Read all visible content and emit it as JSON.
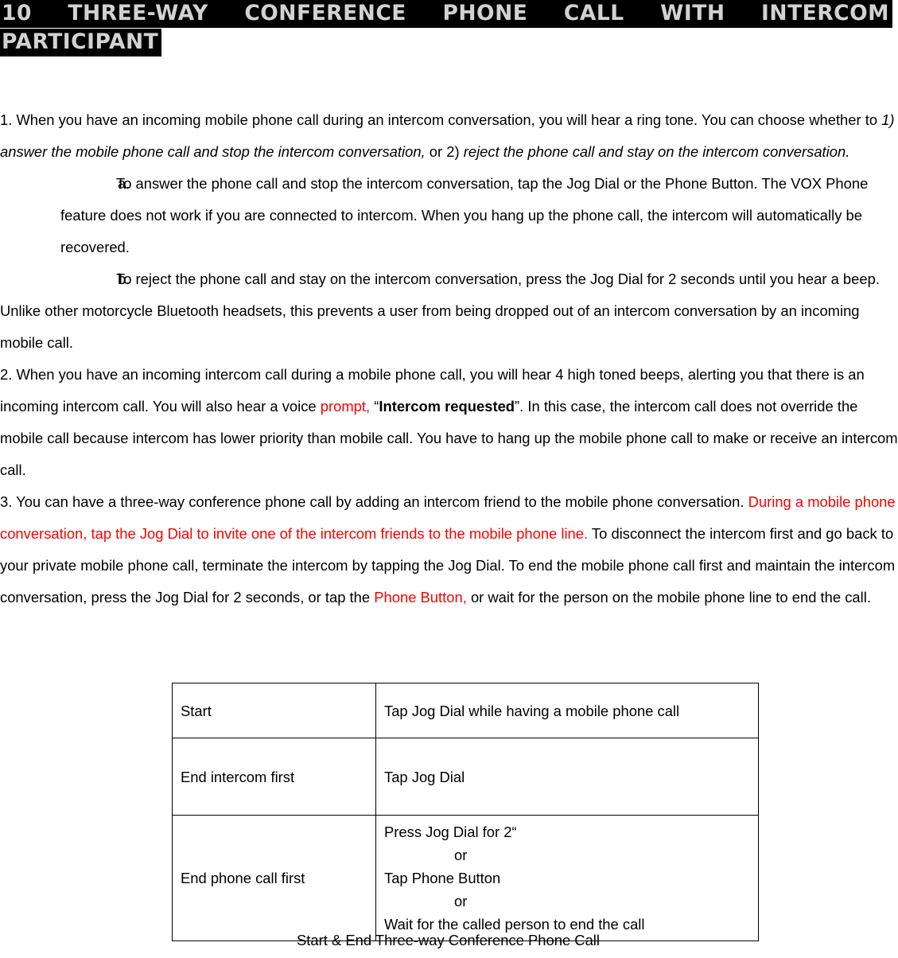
{
  "title": {
    "line1": "10  THREE-WAY  CONFERENCE  PHONE  CALL  WITH  INTERCOM",
    "line2": "PARTICIPANT"
  },
  "colors": {
    "accent_red": "#ff0000",
    "title_text": "#d2d2d2",
    "title_highlight": "#000000"
  },
  "body": {
    "p1": {
      "part1": "1. When you have an incoming mobile phone call during an intercom conversation, you will hear a ring tone. You can choose whether to ",
      "italic1": "1) answer the mobile phone call and stop the intercom conversation,",
      "part2": " or 2) ",
      "italic2": "reject the phone call and stay on the intercom conversation."
    },
    "sub_a": {
      "marker": "a.",
      "text": "To answer the  phone call and stop the intercom conversation, tap the Jog Dial or the Phone Button. The VOX Phone feature does not work if you are connected to intercom. When you hang up the phone call, the intercom will automatically be recovered."
    },
    "sub_b": {
      "marker": "b.",
      "text": "To reject the phone call and stay on the intercom conversation, press the Jog Dial for 2 seconds until you hear a beep."
    },
    "p_unlike": "Unlike other motorcycle Bluetooth headsets, this prevents a user from being dropped out of an intercom conversation by an incoming mobile call.",
    "p2": {
      "part1": "2. When you have an incoming intercom call during a mobile phone call, you will hear 4 high toned beeps, alerting you that there is an incoming intercom call. You will also hear a voice ",
      "red1": "prompt,",
      "part2": " “",
      "bold1": "Intercom requested",
      "part3": "”. In this case, the intercom call does not override the mobile call because intercom has lower priority than mobile call. You have to hang up the mobile phone call to make or receive an intercom call."
    },
    "p3": {
      "part1": "3. You can have a three-way conference phone call by adding an intercom friend to the mobile phone conversation. ",
      "red1": "During a mobile phone conversation, tap the Jog Dial to invite one of the intercom friends to the mobile phone line.",
      "part2": " To disconnect the intercom first and go back to your private mobile phone call, terminate the intercom by tapping the Jog Dial. To end the mobile phone call first and maintain the intercom conversation, press the Jog Dial for 2 seconds, or tap the ",
      "red2": "Phone Button,",
      "part3": " or wait for the person on the mobile phone line to end the call."
    }
  },
  "table": {
    "rows": [
      {
        "label": "Start",
        "value_lines": [
          "Tap Jog Dial while having a mobile phone call"
        ]
      },
      {
        "label": "End intercom first",
        "value_lines": [
          "Tap Jog Dial"
        ]
      },
      {
        "label": "End phone call first",
        "value_lines": [
          "Press Jog Dial for 2“",
          "or",
          "Tap Phone Button",
          "or",
          "Wait for the called person to end the call"
        ]
      }
    ],
    "caption": "Start & End Three-way Conference Phone Call"
  }
}
